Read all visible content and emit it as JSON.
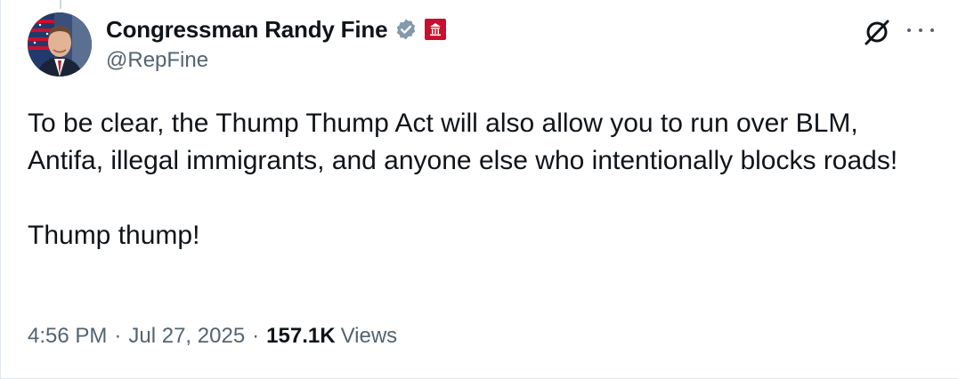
{
  "post": {
    "display_name": "Congressman Randy Fine",
    "handle": "@RepFine",
    "text_lines": [
      "To be clear, the Thump Thump Act will also allow you to run over BLM, Antifa, illegal immigrants, and anyone else who intentionally blocks roads!",
      "Thump thump!"
    ],
    "time": "4:56 PM",
    "separator": "·",
    "date": "Jul 27, 2025",
    "views_count": "157.1K",
    "views_label": "Views"
  },
  "icons": {
    "verified": "verified-badge-icon",
    "affiliation": "us-government-seal-icon",
    "grok": "grok-icon",
    "more": "more-options-icon"
  },
  "colors": {
    "text_primary": "#0f1419",
    "text_secondary": "#536471",
    "verified_badge": "#829aab",
    "affiliation_badge": "#c8102e"
  }
}
